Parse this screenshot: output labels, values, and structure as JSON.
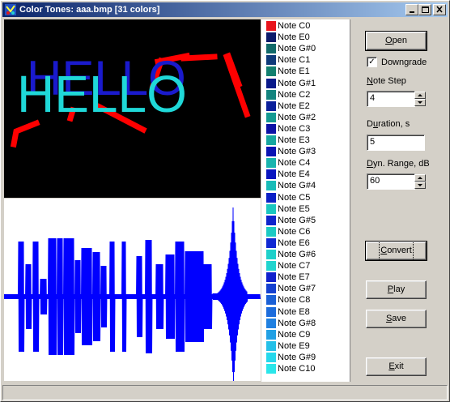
{
  "window": {
    "title": "Color Tones: aaa.bmp [31 colors]",
    "caption_buttons": {
      "minimize": "_",
      "maximize": "□",
      "close": "×"
    }
  },
  "image": {
    "text": "HELLO",
    "colors": {
      "background": "#000000",
      "text_front": "#1fd8d8",
      "text_back": "#1a1acc",
      "strokes": "#ff0000"
    }
  },
  "waveform": {
    "color": "#0000ff",
    "background": "#ffffff"
  },
  "palette": [
    {
      "label": "Note C0",
      "color": "#e8141c"
    },
    {
      "label": "Note E0",
      "color": "#0c1a6a"
    },
    {
      "label": "Note G#0",
      "color": "#116a6a"
    },
    {
      "label": "Note C1",
      "color": "#0e3a7a"
    },
    {
      "label": "Note E1",
      "color": "#128070"
    },
    {
      "label": "Note G#1",
      "color": "#0a1a8a"
    },
    {
      "label": "Note C2",
      "color": "#14847e"
    },
    {
      "label": "Note E2",
      "color": "#0b1f9a"
    },
    {
      "label": "Note G#2",
      "color": "#159a92"
    },
    {
      "label": "Note C3",
      "color": "#0c12a6"
    },
    {
      "label": "Note E3",
      "color": "#16a6a0"
    },
    {
      "label": "Note G#3",
      "color": "#0b14b4"
    },
    {
      "label": "Note C4",
      "color": "#18b4ae"
    },
    {
      "label": "Note E4",
      "color": "#0a16c0"
    },
    {
      "label": "Note G#4",
      "color": "#18bcb8"
    },
    {
      "label": "Note C5",
      "color": "#0c20c6"
    },
    {
      "label": "Note E5",
      "color": "#1ac6c0"
    },
    {
      "label": "Note G#5",
      "color": "#1024cc"
    },
    {
      "label": "Note C6",
      "color": "#1ccac4"
    },
    {
      "label": "Note E6",
      "color": "#1028d2"
    },
    {
      "label": "Note G#6",
      "color": "#1ed0ca"
    },
    {
      "label": "Note C7",
      "color": "#20d4ce"
    },
    {
      "label": "Note E7",
      "color": "#1020cc"
    },
    {
      "label": "Note G#7",
      "color": "#1440d0"
    },
    {
      "label": "Note C8",
      "color": "#1a60d6"
    },
    {
      "label": "Note E8",
      "color": "#1c6cdc"
    },
    {
      "label": "Note G#8",
      "color": "#2080e0"
    },
    {
      "label": "Note C9",
      "color": "#22a0e4"
    },
    {
      "label": "Note E9",
      "color": "#24c0e8"
    },
    {
      "label": "Note G#9",
      "color": "#26d8ec"
    },
    {
      "label": "Note C10",
      "color": "#2ae6ea"
    }
  ],
  "controls": {
    "open": {
      "label_u": "O",
      "label_rest": "pen"
    },
    "downgrade": {
      "label": "Downgrade",
      "checked": true,
      "check_mark": "✓"
    },
    "note_step": {
      "label_u": "N",
      "label_rest": "ote Step",
      "value": "4"
    },
    "duration": {
      "label_pre": "D",
      "label_u": "u",
      "label_rest": "ration, s",
      "value": "5"
    },
    "dyn_range": {
      "label_u": "D",
      "label_rest": "yn. Range, dB",
      "value": "60"
    },
    "convert": {
      "label_u": "C",
      "label_rest": "onvert"
    },
    "play": {
      "label_u": "P",
      "label_rest": "lay"
    },
    "save": {
      "label_u": "S",
      "label_rest": "ave"
    },
    "exit": {
      "label_u": "E",
      "label_rest": "xit"
    }
  },
  "status": {
    "text": ""
  }
}
